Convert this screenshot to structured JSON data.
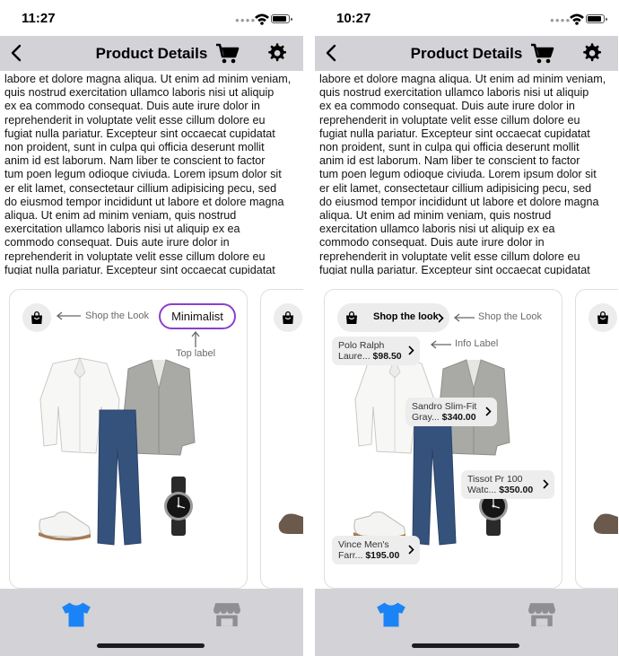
{
  "screens": [
    {
      "id": "left",
      "status_time": "11:27",
      "nav": {
        "title": "Product Details",
        "back": "back-chevron",
        "actions": [
          "cart-icon",
          "gear-icon"
        ]
      },
      "body_text": "labore et dolore magna aliqua. Ut enim ad minim veniam,\nquis nostrud exercitation ullamco laboris nisi ut aliquip\nex ea commodo consequat. Duis aute irure dolor in\nreprehenderit in voluptate velit esse cillum dolore eu\nfugiat nulla pariatur. Excepteur sint occaecat cupidatat\nnon proident, sunt in culpa qui officia deserunt mollit\nanim id est laborum. Nam liber te conscient to factor\ntum poen legum odioque civiuda. Lorem ipsum dolor sit\ner elit lamet, consectetaur cillium adipisicing pecu, sed\ndo eiusmod tempor incididunt ut labore et dolore magna\naliqua. Ut enim ad minim veniam, quis nostrud\nexercitation ullamco laboris nisi ut aliquip ex ea\ncommodo consequat. Duis aute irure dolor in\nreprehenderit in voluptate velit esse cillum dolore eu\nfugiat nulla pariatur. Excepteur sint occaecat cupidatat",
      "card": {
        "shop_the_look_annotation": "Shop the Look",
        "top_label": "Minimalist",
        "top_label_annotation": "Top label"
      },
      "tabs": [
        {
          "icon": "shirt-icon",
          "active": true
        },
        {
          "icon": "store-icon",
          "active": false
        }
      ]
    },
    {
      "id": "right",
      "status_time": "10:27",
      "nav": {
        "title": "Product Details",
        "back": "back-chevron",
        "actions": [
          "cart-icon",
          "gear-icon"
        ]
      },
      "body_text": "labore et dolore magna aliqua. Ut enim ad minim veniam,\nquis nostrud exercitation ullamco laboris nisi ut aliquip\nex ea commodo consequat. Duis aute irure dolor in\nreprehenderit in voluptate velit esse cillum dolore eu\nfugiat nulla pariatur. Excepteur sint occaecat cupidatat\nnon proident, sunt in culpa qui officia deserunt mollit\nanim id est laborum. Nam liber te conscient to factor\ntum poen legum odioque civiuda. Lorem ipsum dolor sit\ner elit lamet, consectetaur cillium adipisicing pecu, sed\ndo eiusmod tempor incididunt ut labore et dolore magna\naliqua. Ut enim ad minim veniam, quis nostrud\nexercitation ullamco laboris nisi ut aliquip ex ea\ncommodo consequat. Duis aute irure dolor in\nreprehenderit in voluptate velit esse cillum dolore eu\nfugiat nulla pariatur. Excepteur sint occaecat cupidatat",
      "card": {
        "shop_the_look_label": "Shop the look",
        "shop_the_look_annotation": "Shop the Look",
        "info_label_annotation": "Info Label",
        "products": [
          {
            "name": "Polo Ralph",
            "name_cont": "Laure...",
            "price": "$98.50"
          },
          {
            "name": "Sandro Slim-Fit",
            "name_cont": "Gray...",
            "price": "$340.00"
          },
          {
            "name": "Tissot Pr 100",
            "name_cont": "Watc...",
            "price": "$350.00"
          },
          {
            "name": "Vince Men's",
            "name_cont": "Farr...",
            "price": "$195.00"
          }
        ]
      },
      "tabs": [
        {
          "icon": "shirt-icon",
          "active": true
        },
        {
          "icon": "store-icon",
          "active": false
        }
      ]
    }
  ],
  "colors": {
    "nav_bg": "#d2d2d7",
    "tab_active": "#1a84f7",
    "tab_inactive": "#8e8e93",
    "top_label_border": "#8a3fd1"
  }
}
